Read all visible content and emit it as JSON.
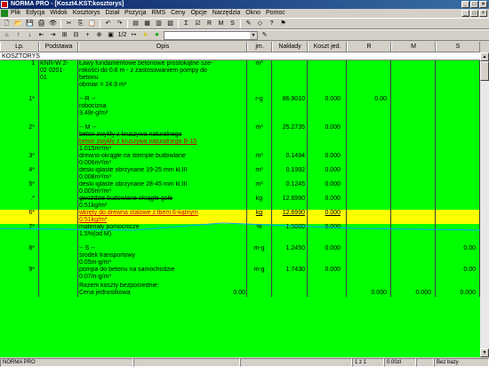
{
  "window": {
    "title": "NORMA PRO - [Koszt4.KST:kosztorys]",
    "controls": [
      "_",
      "□",
      "×"
    ]
  },
  "menu": [
    "Plik",
    "Edycja",
    "Widok",
    "Kosztorys",
    "Dział",
    "Pozycja",
    "RMS",
    "Ceny",
    "Opcje",
    "Narzędzia",
    "Okno",
    "Pomoc"
  ],
  "toolbar1": [
    "🗋",
    "📂",
    "💾",
    "🖨",
    "👁",
    "✂",
    "⎘",
    "📋",
    "↶",
    "↷",
    "▤",
    "▦",
    "▥",
    "▧",
    "Σ",
    "☑",
    "R",
    "M",
    "S",
    "✎",
    "◇",
    "?",
    "⚑"
  ],
  "toolbar2": {
    "icons": [
      "⌂",
      "↑",
      "↓",
      "⇤",
      "⇥",
      "⊞",
      "⊟",
      "+",
      "⊕",
      "▣",
      "1/2",
      "↦",
      "★",
      "★"
    ],
    "combo_value": "",
    "combo2_icon": "✎"
  },
  "columns": [
    "Lp.",
    "Podstawa",
    "Opis",
    "jm.",
    "Nakłady",
    "Koszt jed.",
    "R",
    "M",
    "S"
  ],
  "group_label": "KOSZTORYS",
  "rows": [
    {
      "lp": "1",
      "pod": "KNR-W 2-\n02 0201-\n01",
      "op": "Ławy fundamentowe betonowe prostokątne sze-\nrokości do 0.6 m - z zastosowaniem pompy do\nbetonu\nobmiar = 24.9 m³",
      "jm": "m³",
      "nak": "",
      "kos": "",
      "r": "",
      "m": "",
      "s": "",
      "h": 40,
      "style": ""
    },
    {
      "lp": "1*",
      "pod": "",
      "op": "-- R --\nrobocizna\n3.49r-g/m³",
      "jm": "r-g",
      "nak": "86.9010",
      "kos": "0.000",
      "r": "0.00",
      "m": "",
      "s": "",
      "h": 32,
      "style": ""
    },
    {
      "lp": "2*",
      "pod": "",
      "op": "-- M --\nbeton zwykły z kruszywa naturalnego\nbeton zwykły z kruszywa naturalnego B-15\n1.015m³/m³",
      "jm": "m³",
      "nak": "25.2735",
      "kos": "0.000",
      "r": "",
      "m": "",
      "s": "",
      "h": 32,
      "style": "beton"
    },
    {
      "lp": "3*",
      "pod": "",
      "op": "drewno okrągłe na stemple budowlane\n0.006m³/m³",
      "jm": "m³",
      "nak": "0.1494",
      "kos": "0.000",
      "r": "",
      "m": "",
      "s": "",
      "h": 16,
      "style": ""
    },
    {
      "lp": "4*",
      "pod": "",
      "op": "deski iglaste obrzynane 19-25 mm kl.III\n0.008m³/m³",
      "jm": "m³",
      "nak": "0.1992",
      "kos": "0.000",
      "r": "",
      "m": "",
      "s": "",
      "h": 16,
      "style": ""
    },
    {
      "lp": "5*",
      "pod": "",
      "op": "deski iglaste obrzynane 28-45 mm kl.III\n0.005m³/m³",
      "jm": "m³",
      "nak": "0.1245",
      "kos": "0.000",
      "r": "",
      "m": "",
      "s": "",
      "h": 16,
      "style": ""
    },
    {
      "lp": ".*",
      "pod": "",
      "op": "gwoździe budowlane okrągłe gołe\n0.51kg/m³",
      "jm": "kg",
      "nak": "12.6990",
      "kos": "0.000",
      "r": "",
      "m": "",
      "s": "",
      "h": 16,
      "style": "strike"
    },
    {
      "lp": "6*",
      "pod": "",
      "op": "wkręty do drewna stalowe z łbem 6-kątnym\n0.51kg/m³",
      "jm": "kg",
      "nak": "12.6990",
      "kos": "0.000",
      "r": "",
      "m": "",
      "s": "",
      "h": 16,
      "style": "yellow"
    },
    {
      "lp": "7*",
      "pod": "",
      "op": "materiały pomocnicze\n1.5%(od M)",
      "jm": "%",
      "nak": "1.5000",
      "kos": "0.000",
      "r": "",
      "m": "",
      "s": "",
      "h": 24,
      "style": ""
    },
    {
      "lp": "8*",
      "pod": "",
      "op": "-- S --\nśrodek transportowy\n0.05m-g/m³",
      "jm": "m-g",
      "nak": "1.2450",
      "kos": "0.000",
      "r": "",
      "m": "",
      "s": "0.00",
      "h": 24,
      "style": ""
    },
    {
      "lp": "9*",
      "pod": "",
      "op": "pompa do betonu na samochodzie\n0.07m-g/m³",
      "jm": "m-g",
      "nak": "1.7430",
      "kos": "0.000",
      "r": "",
      "m": "",
      "s": "0.00",
      "h": 18,
      "style": ""
    },
    {
      "lp": "",
      "pod": "",
      "op": "Razem koszty bezpośrednie:\nCena jednostkowa",
      "jm": "",
      "nak": "",
      "kos": "",
      "r": "0.000",
      "m": "0.000",
      "s": "0.000",
      "h": 16,
      "style": "total",
      "op_val": "0.00"
    }
  ],
  "status": [
    "NORMA PRO",
    "",
    "",
    "1 z 1",
    "0.00zł",
    "",
    "Bez bazy"
  ]
}
